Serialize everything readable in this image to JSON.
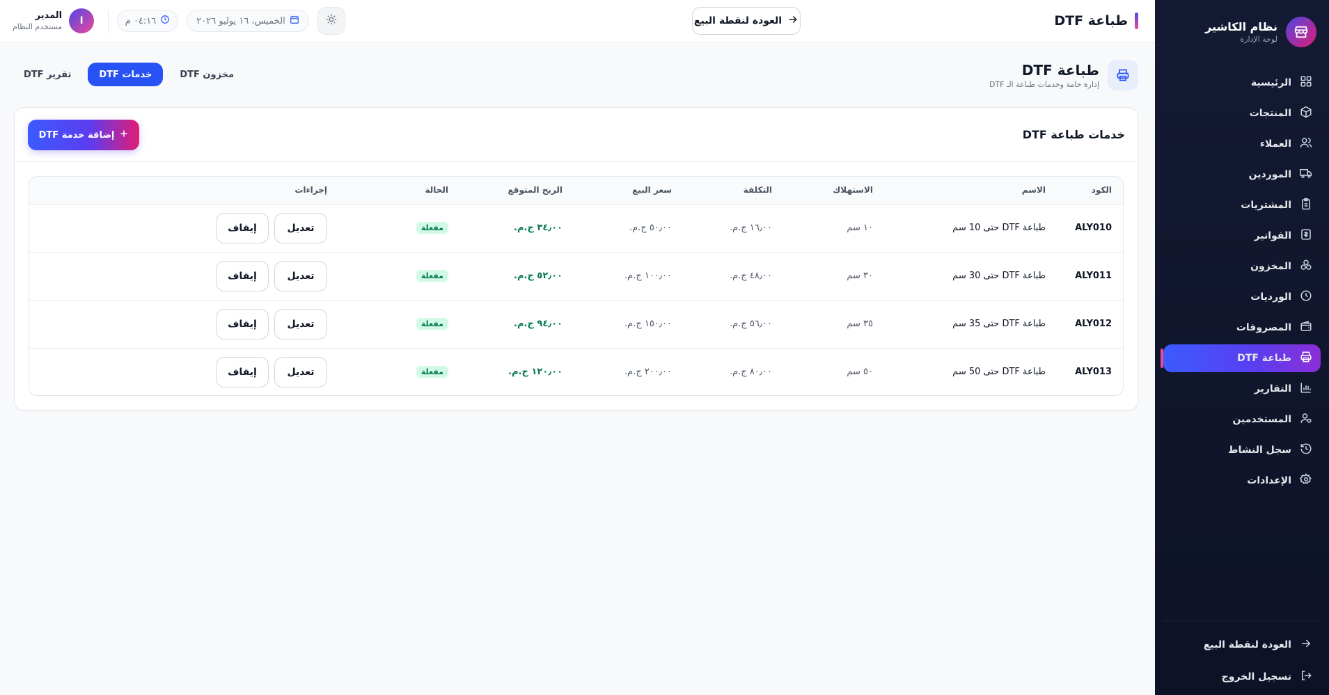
{
  "sidebar": {
    "brand_title": "نظام الكاشير",
    "brand_sub": "لوحة الإدارة",
    "items": [
      {
        "label": "الرئيسية",
        "icon": "grid-icon"
      },
      {
        "label": "المنتجات",
        "icon": "box-icon"
      },
      {
        "label": "العملاء",
        "icon": "users-icon"
      },
      {
        "label": "الموردين",
        "icon": "truck-icon"
      },
      {
        "label": "المشتريات",
        "icon": "clipboard-icon"
      },
      {
        "label": "الفواتير",
        "icon": "receipt-icon"
      },
      {
        "label": "المخزون",
        "icon": "boxes-icon"
      },
      {
        "label": "الورديات",
        "icon": "clock-icon"
      },
      {
        "label": "المصروفات",
        "icon": "wallet-icon"
      },
      {
        "label": "طباعة DTF",
        "icon": "printer-icon",
        "active": true
      },
      {
        "label": "التقارير",
        "icon": "bar-chart-icon"
      },
      {
        "label": "المستخدمين",
        "icon": "user-cog-icon"
      },
      {
        "label": "سجل النشاط",
        "icon": "history-icon"
      },
      {
        "label": "الإعدادات",
        "icon": "gear-icon"
      }
    ],
    "bottom": {
      "back_pos": "العودة لنقطة البيع",
      "logout": "تسجيل الخروج"
    }
  },
  "topbar": {
    "title": "طباعة DTF",
    "back_button": "العودة لنقطة البيع",
    "date": "الخميس، ١٦ يوليو ٢٠٢٦",
    "time": "٠٤:١٦ م",
    "user_name": "المدير",
    "user_role": "مستخدم النظام",
    "avatar_letter": "ا"
  },
  "page": {
    "title": "طباعة DTF",
    "subtitle": "إدارة خامة وخدمات طباعة الـ DTF",
    "tabs": [
      {
        "label": "مخزون DTF"
      },
      {
        "label": "خدمات DTF",
        "active": true
      },
      {
        "label": "تقرير DTF"
      }
    ]
  },
  "card": {
    "title": "خدمات طباعة DTF",
    "add_button": "إضافة خدمة DTF",
    "columns": [
      "الكود",
      "الاسم",
      "الاستهلاك",
      "التكلفة",
      "سعر البيع",
      "الربح المتوقع",
      "الحالة",
      "إجراءات"
    ],
    "rows": [
      {
        "code": "ALY010",
        "name": "طباعة DTF حتى 10 سم",
        "usage": "١٠ سم",
        "cost": "١٦٫٠٠ ج.م.",
        "price": "٥٠٫٠٠ ج.م.",
        "profit": "٣٤٫٠٠ ج.م.",
        "status": "مفعلة",
        "edit": "تعديل",
        "stop": "إيقاف"
      },
      {
        "code": "ALY011",
        "name": "طباعة DTF حتى 30 سم",
        "usage": "٣٠ سم",
        "cost": "٤٨٫٠٠ ج.م.",
        "price": "١٠٠٫٠٠ ج.م.",
        "profit": "٥٢٫٠٠ ج.م.",
        "status": "مفعلة",
        "edit": "تعديل",
        "stop": "إيقاف"
      },
      {
        "code": "ALY012",
        "name": "طباعة DTF حتى 35 سم",
        "usage": "٣٥ سم",
        "cost": "٥٦٫٠٠ ج.م.",
        "price": "١٥٠٫٠٠ ج.م.",
        "profit": "٩٤٫٠٠ ج.م.",
        "status": "مفعلة",
        "edit": "تعديل",
        "stop": "إيقاف"
      },
      {
        "code": "ALY013",
        "name": "طباعة DTF حتى 50 سم",
        "usage": "٥٠ سم",
        "cost": "٨٠٫٠٠ ج.م.",
        "price": "٢٠٠٫٠٠ ج.م.",
        "profit": "١٢٠٫٠٠ ج.م.",
        "status": "مفعلة",
        "edit": "تعديل",
        "stop": "إيقاف"
      }
    ]
  },
  "colors": {
    "sidebar_bg": "#141a33",
    "accent_blue": "#2952f5",
    "accent_pink": "#ec4899",
    "success": "#047857"
  }
}
